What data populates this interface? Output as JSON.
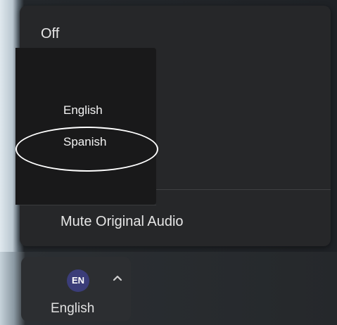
{
  "menu": {
    "off_label": "Off",
    "languages": [
      {
        "label": "English"
      },
      {
        "label": "Spanish"
      }
    ],
    "mute_label": "Mute Original Audio"
  },
  "language_button": {
    "badge": "EN",
    "label": "English",
    "chevron_icon": "chevron-up-icon"
  },
  "colors": {
    "menu_background": "#262729",
    "submenu_background": "#19191a",
    "badge_background": "#3b3d79",
    "annotation": "#ffffff"
  }
}
